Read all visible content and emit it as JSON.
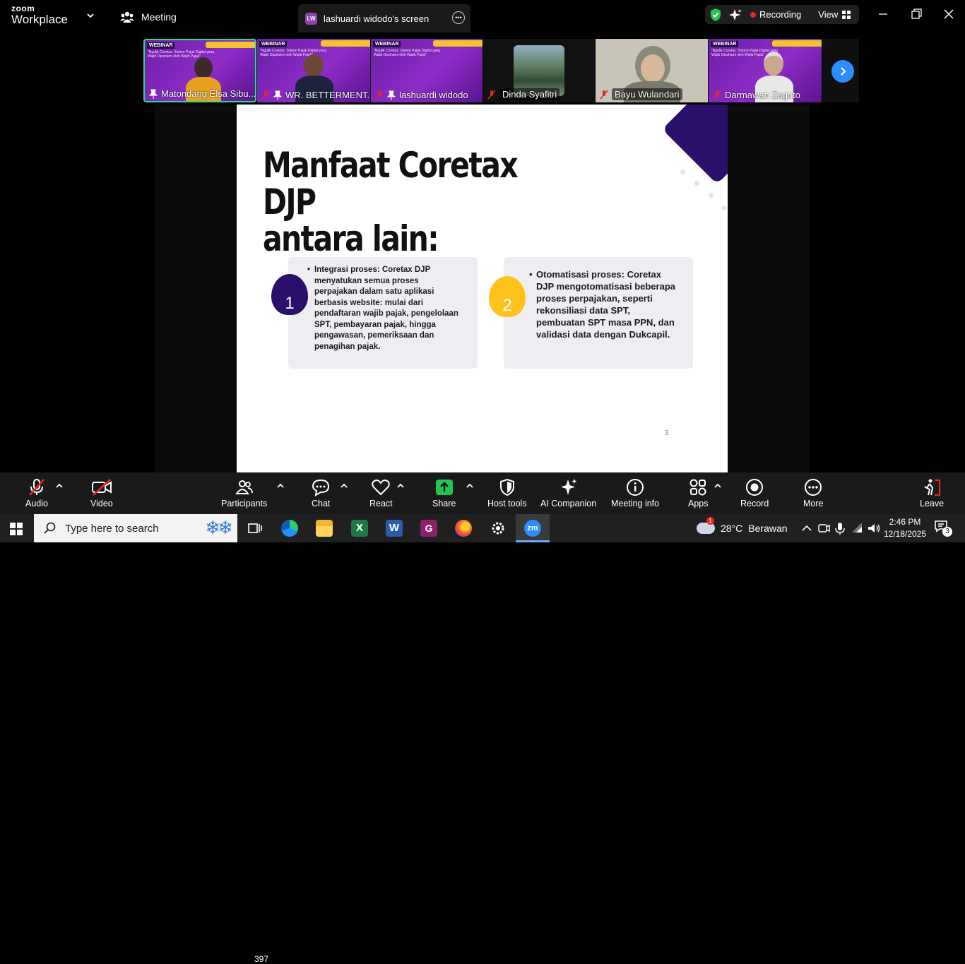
{
  "app": {
    "brand_top": "zoom",
    "brand_bottom": "Workplace"
  },
  "header": {
    "meeting_label": "Meeting",
    "screen_tab": {
      "badge": "LW",
      "title": "lashuardi widodo's screen"
    },
    "recording_label": "Recording",
    "view_label": "View"
  },
  "participants_strip": [
    {
      "name": "Matondang Elsa Sibu...",
      "active": true,
      "pinned": true,
      "muted": false
    },
    {
      "name": "WR. BETTERMENT...",
      "pinned": true,
      "muted": true
    },
    {
      "name": "lashuardi widodo",
      "pinned": true,
      "muted": true
    },
    {
      "name": "Dinda Syafitri",
      "muted": true
    },
    {
      "name": "Bayu Wulandari",
      "muted": true
    },
    {
      "name": "Darmawan Zagoto",
      "muted": true
    }
  ],
  "webinar_label": "WEBINAR",
  "webinar_subtitle": "\"Ngulik Coretax: Sistem Pajak Digital yang Wajib Dipahami oleh Wajib Pajak\"",
  "slide": {
    "title_line1": "Manfaat Coretax DJP",
    "title_line2": "antara lain:",
    "cards": [
      {
        "number": "1",
        "color": "#2a0f6b",
        "text": "Integrasi proses: Coretax DJP menyatukan semua proses perpajakan dalam satu aplikasi berbasis website: mulai dari pendaftaran wajib pajak, pengelolaan SPT, pembayaran pajak, hingga pengawasan, pemeriksaan dan penagihan pajak."
      },
      {
        "number": "2",
        "color": "#ffc21a",
        "text": "Otomatisasi proses: Coretax DJP mengotomatisasi beberapa proses perpajakan, seperti rekonsiliasi data SPT, pembuatan SPT masa PPN, dan validasi data dengan Dukcapil."
      }
    ],
    "page_number": "3"
  },
  "toolbar": {
    "audio": "Audio",
    "video": "Video",
    "participants": "Participants",
    "participants_count": "397",
    "chat": "Chat",
    "react": "React",
    "share": "Share",
    "host_tools": "Host tools",
    "ai_companion": "AI Companion",
    "meeting_info": "Meeting info",
    "apps": "Apps",
    "record": "Record",
    "more": "More",
    "leave": "Leave"
  },
  "taskbar": {
    "search_placeholder": "Type here to search",
    "weather_temp": "28°C",
    "weather_desc": "Berawan",
    "weather_badge": "1",
    "time": "2:46 PM",
    "date": "12/18/2025",
    "notif_count": "3"
  }
}
